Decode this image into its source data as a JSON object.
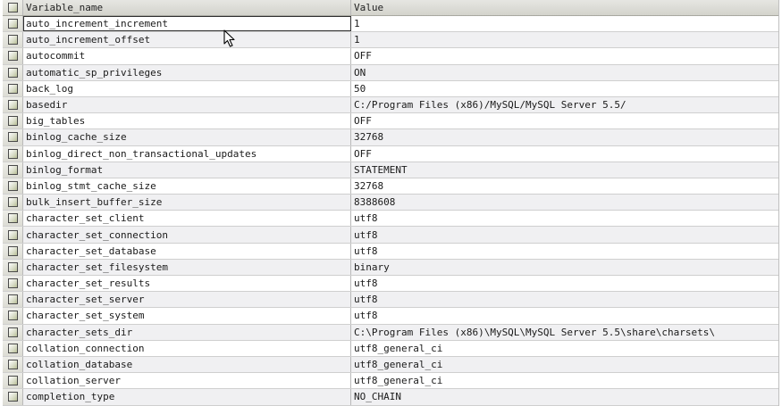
{
  "grid": {
    "columns": {
      "name": "Variable_name",
      "value": "Value"
    },
    "rows": [
      {
        "name": "auto_increment_increment",
        "value": "1"
      },
      {
        "name": "auto_increment_offset",
        "value": "1"
      },
      {
        "name": "autocommit",
        "value": "OFF"
      },
      {
        "name": "automatic_sp_privileges",
        "value": "ON"
      },
      {
        "name": "back_log",
        "value": "50"
      },
      {
        "name": "basedir",
        "value": "C:/Program Files (x86)/MySQL/MySQL Server 5.5/"
      },
      {
        "name": "big_tables",
        "value": "OFF"
      },
      {
        "name": "binlog_cache_size",
        "value": "32768"
      },
      {
        "name": "binlog_direct_non_transactional_updates",
        "value": "OFF"
      },
      {
        "name": "binlog_format",
        "value": "STATEMENT"
      },
      {
        "name": "binlog_stmt_cache_size",
        "value": "32768"
      },
      {
        "name": "bulk_insert_buffer_size",
        "value": "8388608"
      },
      {
        "name": "character_set_client",
        "value": "utf8"
      },
      {
        "name": "character_set_connection",
        "value": "utf8"
      },
      {
        "name": "character_set_database",
        "value": "utf8"
      },
      {
        "name": "character_set_filesystem",
        "value": "binary"
      },
      {
        "name": "character_set_results",
        "value": "utf8"
      },
      {
        "name": "character_set_server",
        "value": "utf8"
      },
      {
        "name": "character_set_system",
        "value": "utf8"
      },
      {
        "name": "character_sets_dir",
        "value": "C:\\Program Files (x86)\\MySQL\\MySQL Server 5.5\\share\\charsets\\"
      },
      {
        "name": "collation_connection",
        "value": "utf8_general_ci"
      },
      {
        "name": "collation_database",
        "value": "utf8_general_ci"
      },
      {
        "name": "collation_server",
        "value": "utf8_general_ci"
      },
      {
        "name": "completion_type",
        "value": "NO_CHAIN"
      }
    ]
  }
}
